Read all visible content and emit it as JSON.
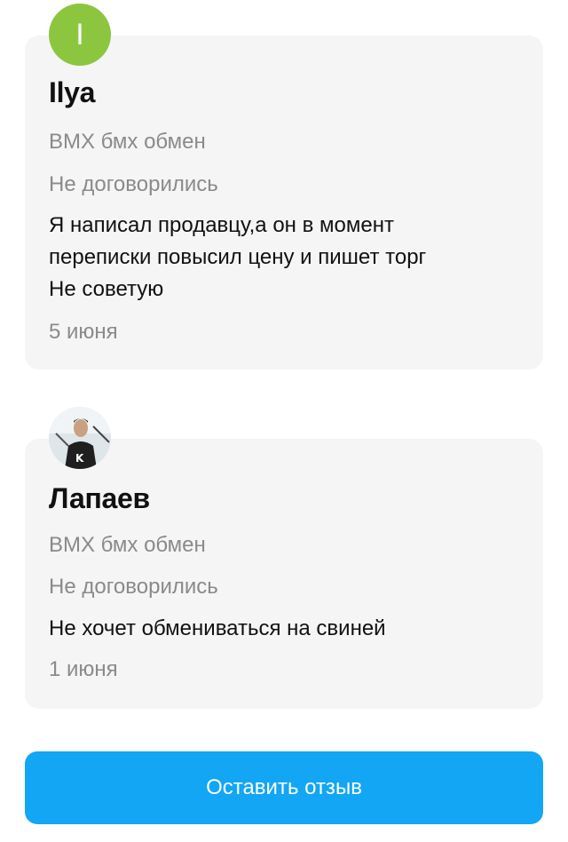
{
  "reviews": [
    {
      "avatar_letter": "I",
      "avatar_color": "#8cc63f",
      "author": "Ilya",
      "item": "BMX бмх обмен",
      "deal_status": "Не договорились",
      "text_lines": [
        "Я написал продавцу,а он в момент",
        "переписки повысил цену и пишет торг",
        "Не советую"
      ],
      "date": "5 июня"
    },
    {
      "avatar_type": "photo",
      "author": "Лапаев",
      "item": "BMX бмх обмен",
      "deal_status": "Не договорились",
      "text_lines": [
        "Не хочет обмениваться на свиней"
      ],
      "date": "1 июня"
    }
  ],
  "cta": {
    "label": "Оставить отзыв",
    "color": "#12a6f5"
  }
}
